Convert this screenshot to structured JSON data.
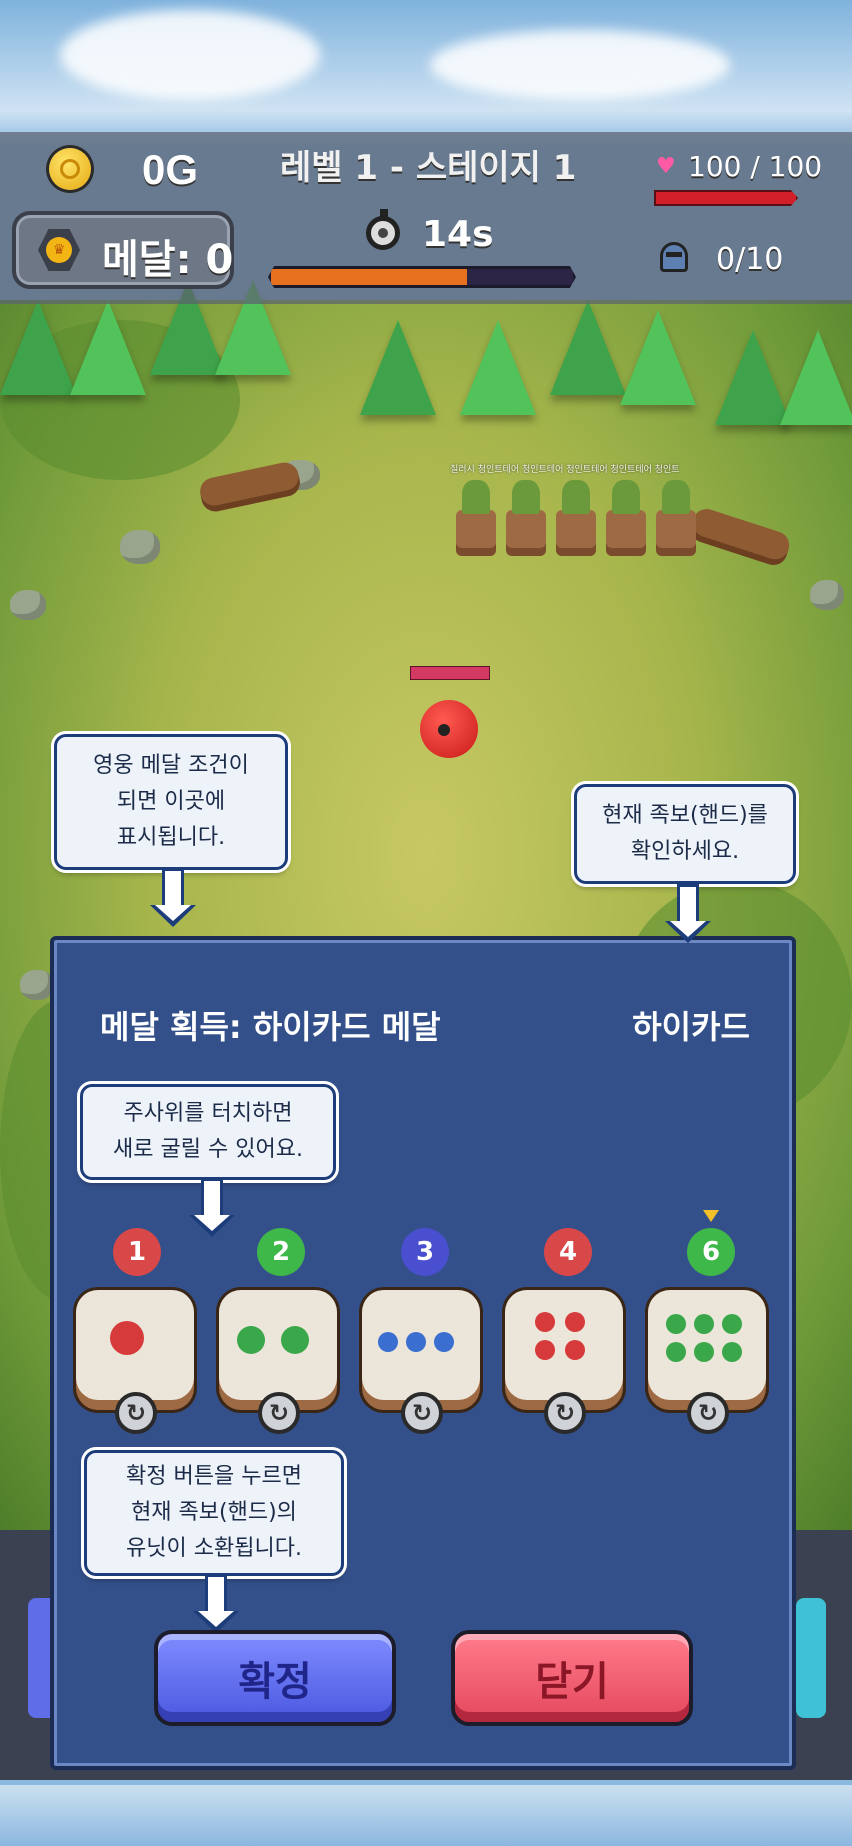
{
  "hud": {
    "gold": "0G",
    "medal": "메달: 0",
    "level": "레벨 1 - 스테이지 1",
    "timer": "14s",
    "timer_progress": 0.65,
    "hp": "100 / 100",
    "hp_progress": 1.0,
    "units": "0/10"
  },
  "field": {
    "enemy_label": "질러시 청인트테어 청인트테어 청인트테어 청인트테어 청인트"
  },
  "tips": {
    "medal_condition": "영웅 메달 조건이\n되면 이곳에\n표시됩니다.",
    "current_hand": "현재 족보(핸드)를\n확인하세요.",
    "dice_touch": "주사위를 터치하면\n새로 굴릴 수 있어요.",
    "confirm_hint": "확정 버튼을 누르면\n현재 족보(핸드)의\n유닛이 소환됩니다."
  },
  "panel": {
    "title": "메달 획득: 하이카드 메달",
    "hand": "하이카드",
    "dice": [
      {
        "value": "1",
        "color": "#d94848"
      },
      {
        "value": "2",
        "color": "#3fb84a"
      },
      {
        "value": "3",
        "color": "#4a4fcf"
      },
      {
        "value": "4",
        "color": "#d94848"
      },
      {
        "value": "6",
        "color": "#3fb84a"
      }
    ],
    "reroll_icon": "reroll-icon",
    "confirm_label": "확정",
    "close_label": "닫기"
  },
  "colors": {
    "panel_bg": "#33508a",
    "confirm": "#5b66f0",
    "close": "#f0566b"
  }
}
